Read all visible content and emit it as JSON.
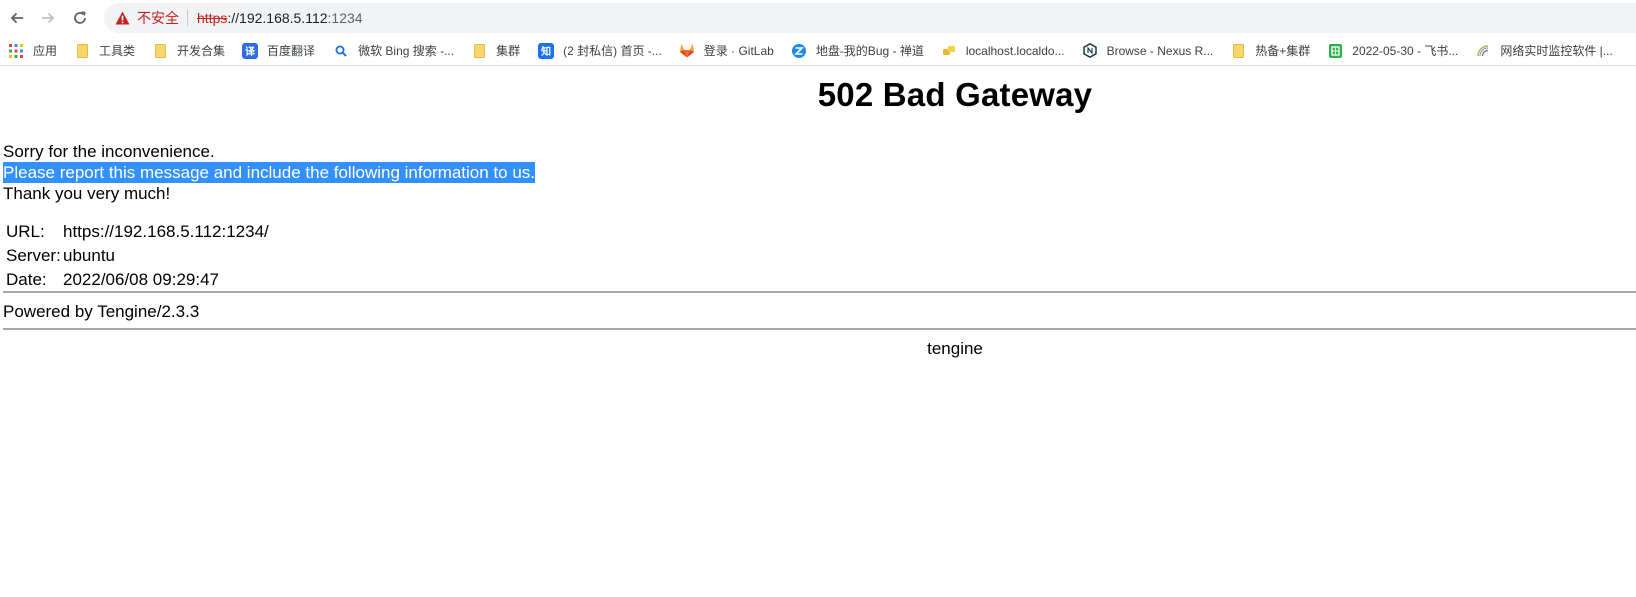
{
  "browser": {
    "insecure_label": "不安全",
    "url_scheme": "https",
    "url_rest": "://192.168.5.112",
    "url_port": ":1234"
  },
  "bookmarks": [
    {
      "label": "应用",
      "icon": "apps-grid-icon"
    },
    {
      "label": "工具类",
      "icon": "folder-icon"
    },
    {
      "label": "开发合集",
      "icon": "folder-icon"
    },
    {
      "label": "百度翻译",
      "icon": "translate-icon",
      "badge": "译",
      "color": "#2e6be6"
    },
    {
      "label": "微软 Bing 搜索 -...",
      "icon": "search-icon"
    },
    {
      "label": "集群",
      "icon": "folder-icon"
    },
    {
      "label": "(2 封私信) 首页 -...",
      "icon": "zhihu-icon",
      "badge": "知",
      "color": "#1772f6"
    },
    {
      "label": "登录 · GitLab",
      "icon": "gitlab-icon"
    },
    {
      "label": "地盘-我的Bug - 禅道",
      "icon": "zentao-icon"
    },
    {
      "label": "localhost.localdo...",
      "icon": "python-icon"
    },
    {
      "label": "Browse - Nexus R...",
      "icon": "nexus-icon"
    },
    {
      "label": "热备+集群",
      "icon": "folder-icon"
    },
    {
      "label": "2022-05-30 - 飞书...",
      "icon": "feishu-icon",
      "color": "#2bb34a"
    },
    {
      "label": "网络实时监控软件 |...",
      "icon": "monitor-icon"
    }
  ],
  "page": {
    "title": "502 Bad Gateway",
    "line1": "Sorry for the inconvenience.",
    "line2": "Please report this message and include the following information to us.",
    "line3": "Thank you very much!",
    "info": {
      "url_key": "URL:",
      "url_val": "https://192.168.5.112:1234/",
      "server_key": "Server:",
      "server_val": "ubuntu",
      "date_key": "Date:",
      "date_val": "2022/06/08 09:29:47"
    },
    "powered_by": "Powered by Tengine/2.3.3",
    "footer": "tengine"
  },
  "colors": {
    "selection": "#3390ff",
    "insecure": "#c5221f"
  }
}
